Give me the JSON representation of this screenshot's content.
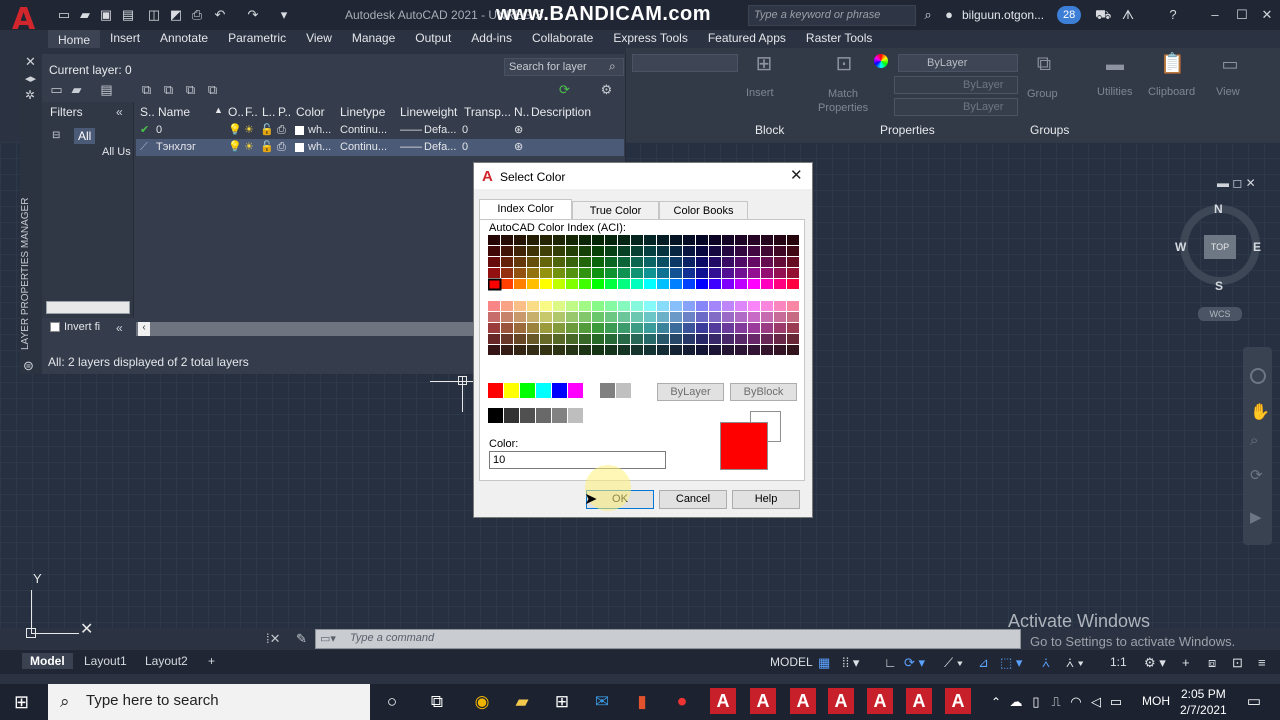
{
  "app": {
    "title": "Autodesk AutoCAD 2021 - UNREGIS",
    "watermark": "www.BANDICAM.com",
    "search_placeholder": "Type a keyword or phrase",
    "user": "bilguun.otgon...",
    "notif_count": "28"
  },
  "ribbon_tabs": [
    "Home",
    "Insert",
    "Annotate",
    "Parametric",
    "View",
    "Manage",
    "Output",
    "Add-ins",
    "Collaborate",
    "Express Tools",
    "Featured Apps",
    "Raster Tools"
  ],
  "ribbon": {
    "insert": "Insert",
    "match_properties_1": "Match",
    "match_properties_2": "Properties",
    "block_panel": "Block",
    "properties_panel": "Properties",
    "groups_panel": "Groups",
    "group": "Group",
    "utilities": "Utilities",
    "clipboard": "Clipboard",
    "view": "View",
    "bylayer_color": "ByLayer",
    "bylayer_linetype": "ByLayer",
    "bylayer_lineweight": "ByLayer"
  },
  "layer_palette": {
    "current_layer": "Current layer: 0",
    "search_placeholder": "Search for layer",
    "side_label": "LAYER PROPERTIES MANAGER",
    "filters_label": "Filters",
    "tree_all": "All",
    "tree_used": "All Us",
    "invert_label": "Invert fi",
    "status": "All: 2 layers displayed of 2 total layers",
    "columns": [
      "S..",
      "Name",
      "O..",
      "F..",
      "L..",
      "P..",
      "Color",
      "Linetype",
      "Lineweight",
      "Transp...",
      "N..",
      "Description"
    ],
    "rows": [
      {
        "name": "0",
        "color": "wh...",
        "linetype": "Continu...",
        "lineweight": "Defa...",
        "transparency": "0"
      },
      {
        "name": "Тэнхлэг",
        "color": "wh...",
        "linetype": "Continu...",
        "lineweight": "Defa...",
        "transparency": "0"
      }
    ]
  },
  "dialog": {
    "title": "Select Color",
    "tabs": [
      "Index Color",
      "True Color",
      "Color Books"
    ],
    "aci_label": "AutoCAD Color Index (ACI):",
    "bylayer_btn": "ByLayer",
    "byblock_btn": "ByBlock",
    "color_label": "Color:",
    "color_value": "10",
    "ok": "OK",
    "cancel": "Cancel",
    "help": "Help",
    "selected_color": "#ff0000"
  },
  "viewcube": {
    "n": "N",
    "s": "S",
    "e": "E",
    "w": "W",
    "top": "TOP",
    "wcs": "WCS"
  },
  "axis": {
    "y": "Y"
  },
  "activate": {
    "line1": "Activate Windows",
    "line2": "Go to Settings to activate Windows."
  },
  "command": {
    "placeholder": "Type a command"
  },
  "layout_tabs": [
    "Model",
    "Layout1",
    "Layout2"
  ],
  "statusbar": {
    "model": "MODEL",
    "scale": "1:1"
  },
  "taskbar": {
    "search": "Type here to search",
    "lang": "MOH",
    "time": "2:05 PM",
    "date": "2/7/2021"
  }
}
